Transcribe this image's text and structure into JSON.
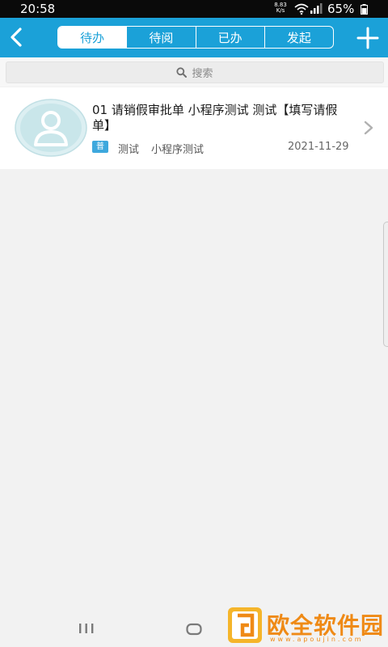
{
  "status_bar": {
    "time": "20:58",
    "net_speed": "8.83",
    "net_unit": "K/s",
    "battery": "65%"
  },
  "header": {
    "tabs": [
      {
        "label": "待办",
        "active": true
      },
      {
        "label": "待阅",
        "active": false
      },
      {
        "label": "已办",
        "active": false
      },
      {
        "label": "发起",
        "active": false
      }
    ],
    "color": "#1ba1d8"
  },
  "search": {
    "placeholder": "搜索"
  },
  "list": [
    {
      "title": "01 请销假审批单 小程序测试 测试【填写请假单】",
      "badge": "普",
      "user": "测试",
      "app": "小程序测试",
      "date": "2021-11-29"
    }
  ],
  "watermark": {
    "text": "欧全软件园",
    "url": "www.apoujin.com"
  },
  "colors": {
    "accent": "#1ba1d8",
    "badge": "#3ea8dd",
    "watermark": "#ef8a16"
  }
}
